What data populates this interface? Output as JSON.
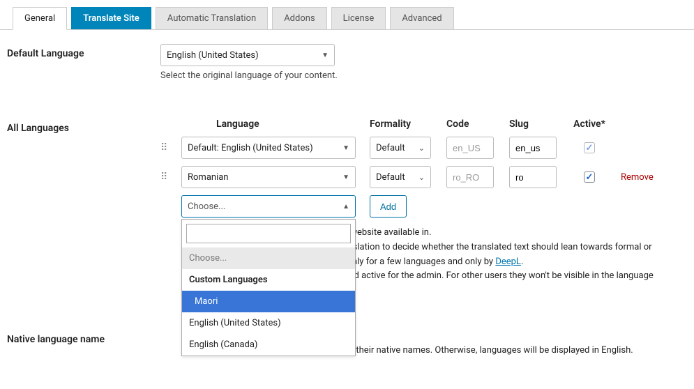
{
  "tabs": {
    "general": "General",
    "translate_site": "Translate Site",
    "automatic": "Automatic Translation",
    "addons": "Addons",
    "license": "License",
    "advanced": "Advanced"
  },
  "default_lang": {
    "label": "Default Language",
    "value": "English (United States)",
    "helper": "Select the original language of your content."
  },
  "all_lang": {
    "label": "All Languages",
    "headers": {
      "language": "Language",
      "formality": "Formality",
      "code": "Code",
      "slug": "Slug",
      "active": "Active*"
    },
    "rows": [
      {
        "language": "Default: English (United States)",
        "formality": "Default",
        "code": "en_US",
        "slug": "en_us"
      },
      {
        "language": "Romanian",
        "formality": "Default",
        "code": "ro_RO",
        "slug": "ro"
      }
    ],
    "remove": "Remove",
    "choose": "Choose...",
    "add": "Add",
    "dropdown": {
      "placeholder": "Choose...",
      "group": "Custom Languages",
      "items": [
        "Maori",
        "English (United States)",
        "English (Canada)"
      ]
    },
    "notes": {
      "line1_tail": "our website available in.",
      "line2_a": " Translation to decide whether the translated text should lean towards formal or ",
      "line2_b": "ed only for a few languages and only by ",
      "deepl": "DeepL",
      "line3": "le and active for the admin. For other users they won't be visible in the language "
    }
  },
  "native": {
    "label": "Native language name",
    "note_tail": "es in their native names. Otherwise, languages will be displayed in English."
  }
}
